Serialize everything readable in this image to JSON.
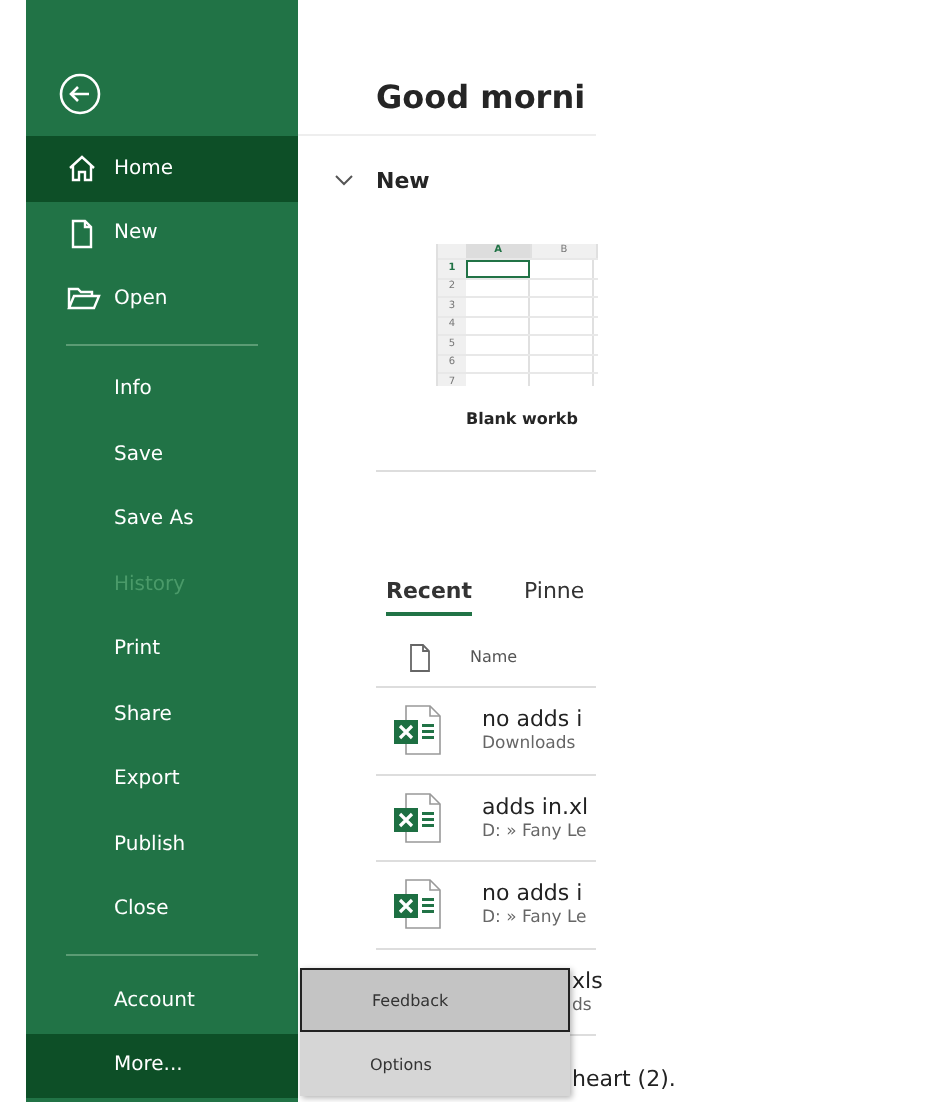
{
  "sidebar": {
    "groups": [
      [
        {
          "label": "Home",
          "kind": "home",
          "selected": true,
          "disabled": false
        },
        {
          "label": "New",
          "kind": "new",
          "selected": false,
          "disabled": false
        },
        {
          "label": "Open",
          "kind": "open",
          "selected": false,
          "disabled": false
        }
      ],
      [
        {
          "label": "Info",
          "kind": "plain",
          "selected": false,
          "disabled": false
        },
        {
          "label": "Save",
          "kind": "plain",
          "selected": false,
          "disabled": false
        },
        {
          "label": "Save As",
          "kind": "plain",
          "selected": false,
          "disabled": false
        },
        {
          "label": "History",
          "kind": "plain",
          "selected": false,
          "disabled": true
        },
        {
          "label": "Print",
          "kind": "plain",
          "selected": false,
          "disabled": false
        },
        {
          "label": "Share",
          "kind": "plain",
          "selected": false,
          "disabled": false
        },
        {
          "label": "Export",
          "kind": "plain",
          "selected": false,
          "disabled": false
        },
        {
          "label": "Publish",
          "kind": "plain",
          "selected": false,
          "disabled": false
        },
        {
          "label": "Close",
          "kind": "plain",
          "selected": false,
          "disabled": false
        }
      ],
      [
        {
          "label": "Account",
          "kind": "plain",
          "selected": false,
          "disabled": false
        },
        {
          "label": "More...",
          "kind": "plain",
          "selected": true,
          "disabled": false
        }
      ]
    ]
  },
  "heading": "Good morni",
  "new_section": {
    "title": "New",
    "expanded": true,
    "template": {
      "label": "Blank workb",
      "columns": [
        "A",
        "B"
      ],
      "rows": [
        "1",
        "2",
        "3",
        "4",
        "5",
        "6",
        "7"
      ]
    }
  },
  "tabs": [
    {
      "label": "Recent",
      "selected": true
    },
    {
      "label": "Pinne",
      "selected": false
    }
  ],
  "files": {
    "column": "Name",
    "rows": [
      {
        "kind": "file",
        "name": "no adds i",
        "location": "Downloads"
      },
      {
        "kind": "file",
        "name": "adds in.xl",
        "location": "D: » Fany Le"
      },
      {
        "kind": "file",
        "name": "no adds i",
        "location": "D: » Fany Le"
      },
      {
        "kind": "covered",
        "name": "xls",
        "location": "ds"
      },
      {
        "kind": "covered",
        "name": "heart (2)."
      }
    ]
  },
  "popup_menu": [
    {
      "label": "Feedback",
      "selected": true
    },
    {
      "label": "Options",
      "selected": false
    }
  ]
}
